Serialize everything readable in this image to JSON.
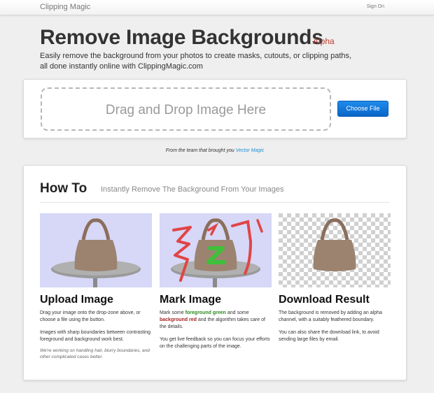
{
  "nav": {
    "brand": "Clipping Magic",
    "sign_in": "Sign On"
  },
  "hero": {
    "title": "Remove Image Backgrounds",
    "badge": "Alpha",
    "subtitle": "Easily remove the background from your photos to create masks, cutouts, or clipping paths, all done instantly online with ClippingMagic.com"
  },
  "upload": {
    "dropzone_text": "Drag and Drop Image Here",
    "button_label": "Choose File"
  },
  "credits": {
    "prefix": "From the team that brought you",
    "link": "Vector Magic"
  },
  "howto": {
    "title": "How To",
    "subtitle": "Instantly Remove The Background From Your Images",
    "steps": [
      {
        "title": "Upload Image",
        "text1": "Drag your image onto the drop-zone above, or choose a file using the button.",
        "text2": "Images with sharp boundaries between contrasting foreground and background work best.",
        "note": "We're working on handling hair, blurry boundaries, and other complicated cases better."
      },
      {
        "title": "Mark Image",
        "text1_a": "Mark some",
        "text1_green": "foreground green",
        "text1_b": "and some",
        "text1_red": "background red",
        "text1_c": "and the algorithm takes care of the details.",
        "text2": "You get live feedback so you can focus your efforts on the challenging parts of the image."
      },
      {
        "title": "Download Result",
        "text1": "The background is removed by adding an alpha channel, with a suitably feathered boundary.",
        "text2": "You can also share the download link, to avoid sending large files by email."
      }
    ]
  },
  "colors": {
    "accent_button": "#0a66c8",
    "alpha_badge": "#c03a2b",
    "link": "#1a8fd6",
    "image_bg": "#d7d7f7",
    "bag": "#9c8370",
    "foreground_mark": "#3fc03a",
    "background_mark": "#e04545"
  },
  "icons": [
    "bag-illustration",
    "checkerboard-transparency"
  ]
}
